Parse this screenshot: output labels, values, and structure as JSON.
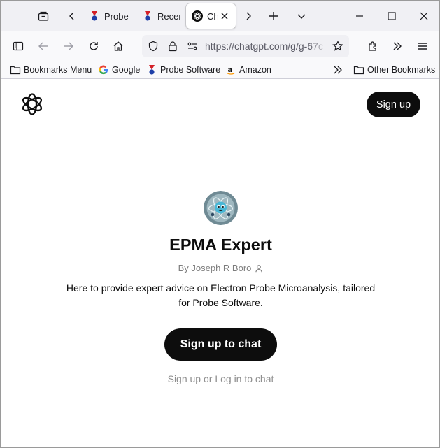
{
  "browser": {
    "tabs": [
      {
        "title": "Probe",
        "favicon": "probe-software-favicon",
        "active": false
      },
      {
        "title": "Recent",
        "favicon": "probe-software-favicon",
        "active": false
      },
      {
        "title": "ChatGPT",
        "favicon": "chatgpt-favicon",
        "active": true
      }
    ],
    "url": "https://chatgpt.com/g/g-67c",
    "bookmarks": [
      {
        "label": "Bookmarks Menu",
        "icon": "folder-icon"
      },
      {
        "label": "Google",
        "icon": "google-icon"
      },
      {
        "label": "Probe Software",
        "icon": "probe-software-favicon"
      },
      {
        "label": "Amazon",
        "icon": "amazon-icon"
      }
    ],
    "other_bookmarks": "Other Bookmarks"
  },
  "header": {
    "signup_label": "Sign up"
  },
  "gpt": {
    "name": "EPMA Expert",
    "byline": "By Joseph R Boro",
    "description": "Here to provide expert advice on Electron Probe Microanalysis, tailored for Probe Software."
  },
  "actions": {
    "signup_chat_label": "Sign up to chat",
    "login_line": "Sign up or Log in to chat"
  },
  "colors": {
    "primary_button": "#0d0d0d",
    "tab_strip": "#f0f0f4",
    "toolbar": "#f9f9fb",
    "muted_text": "#8e8e8e"
  }
}
